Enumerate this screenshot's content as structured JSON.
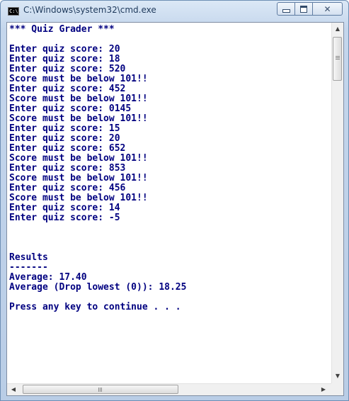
{
  "window": {
    "title": "C:\\Windows\\system32\\cmd.exe",
    "app_icon_text": "C:\\."
  },
  "caption_buttons": {
    "close_glyph": "✕"
  },
  "console": {
    "lines": [
      "*** Quiz Grader ***",
      "",
      "Enter quiz score: 20",
      "Enter quiz score: 18",
      "Enter quiz score: 520",
      "Score must be below 101!!",
      "Enter quiz score: 452",
      "Score must be below 101!!",
      "Enter quiz score: 0145",
      "Score must be below 101!!",
      "Enter quiz score: 15",
      "Enter quiz score: 20",
      "Enter quiz score: 652",
      "Score must be below 101!!",
      "Enter quiz score: 853",
      "Score must be below 101!!",
      "Enter quiz score: 456",
      "Score must be below 101!!",
      "Enter quiz score: 14",
      "Enter quiz score: -5",
      "",
      "",
      "",
      "Results",
      "-------",
      "Average: 17.40",
      "Average (Drop lowest (0)): 18.25",
      "",
      "Press any key to continue . . ."
    ],
    "text_color": "#000080",
    "background": "#ffffff"
  },
  "scrollbars": {
    "up_arrow": "▲",
    "down_arrow": "▼",
    "left_arrow": "◀",
    "right_arrow": "▶",
    "h_thumb_grip": "III"
  }
}
